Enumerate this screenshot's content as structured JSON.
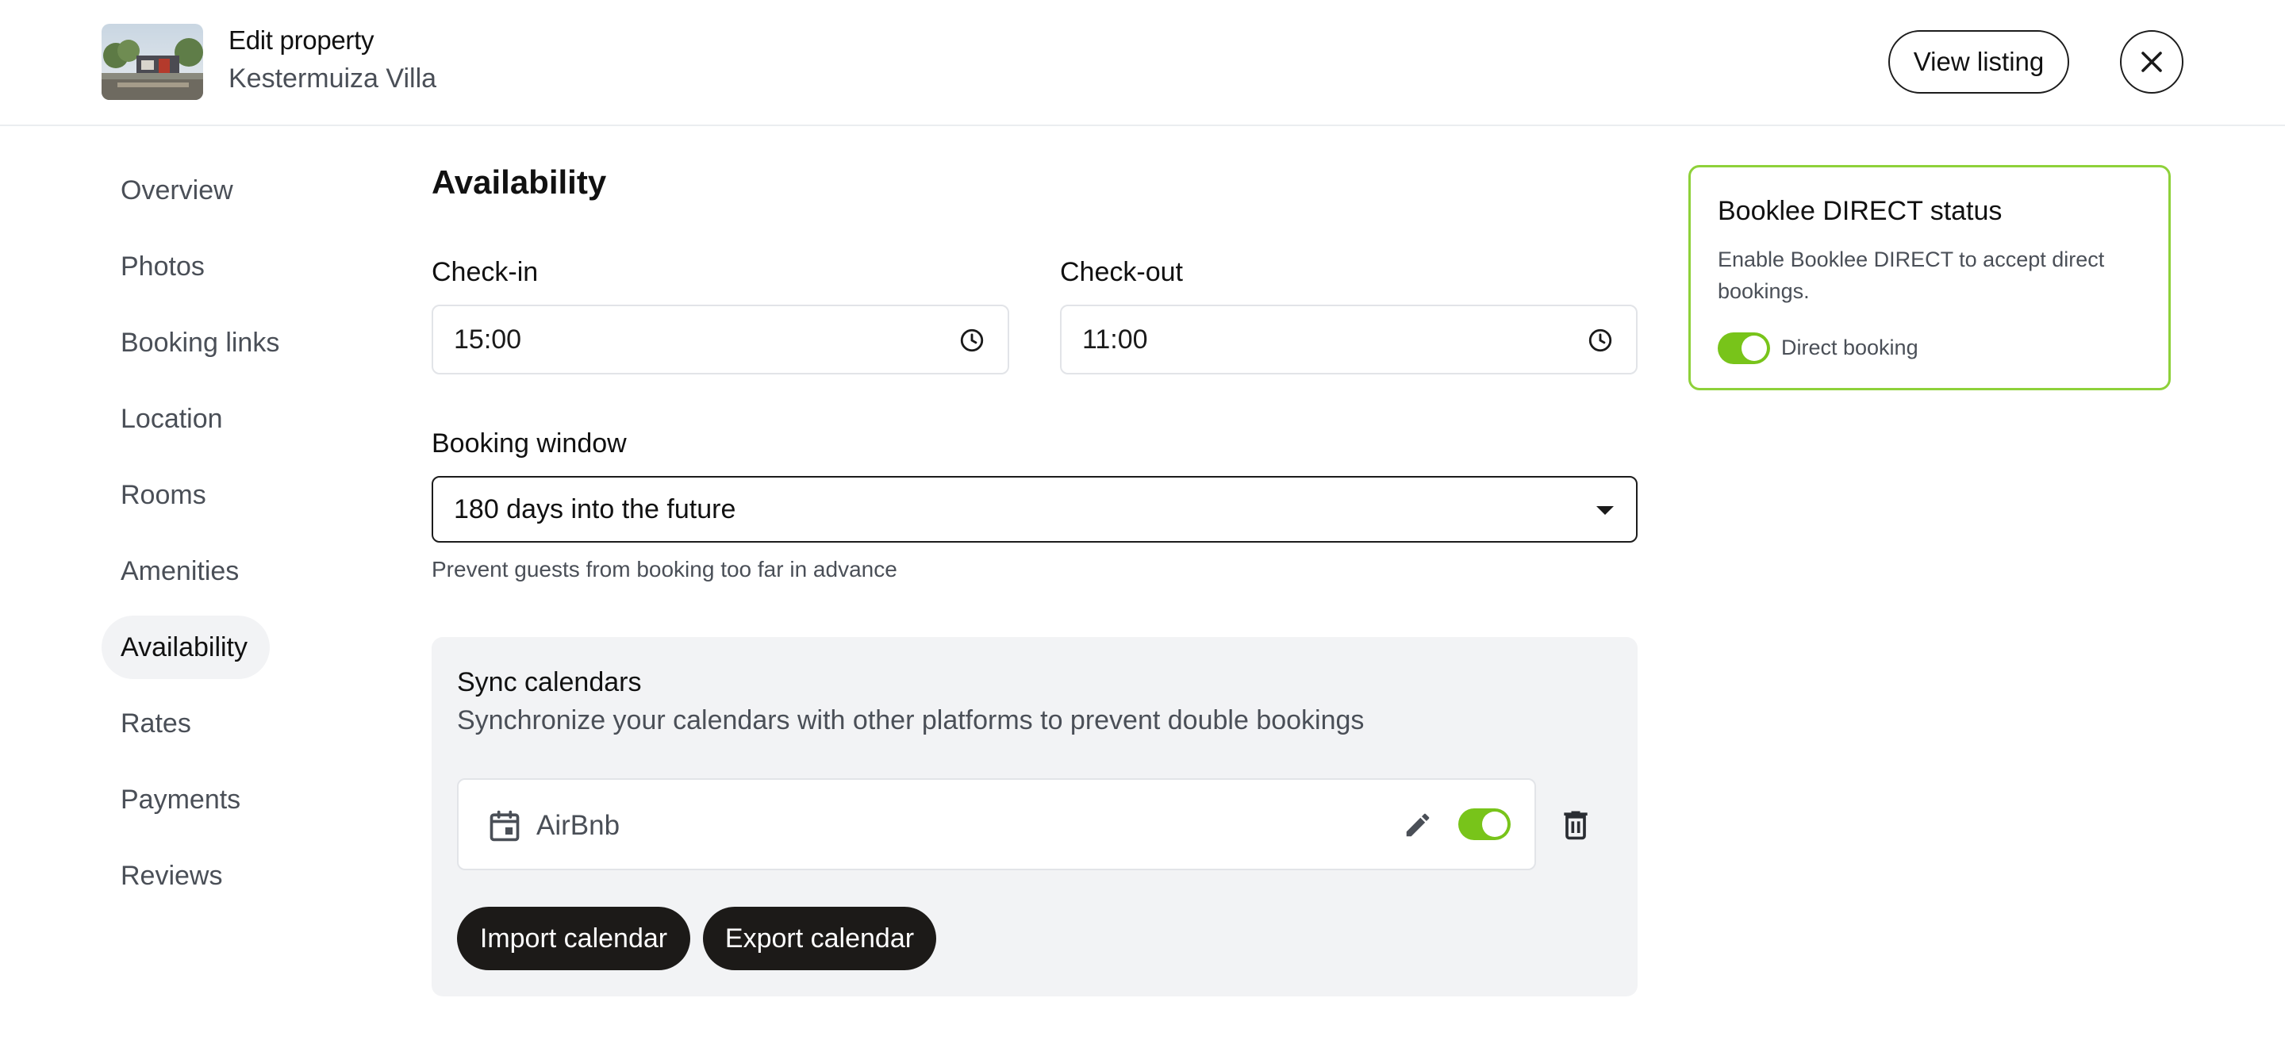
{
  "header": {
    "title": "Edit property",
    "property_name": "Kestermuiza Villa",
    "view_listing_label": "View listing"
  },
  "sidebar": {
    "items": [
      {
        "label": "Overview"
      },
      {
        "label": "Photos"
      },
      {
        "label": "Booking links"
      },
      {
        "label": "Location"
      },
      {
        "label": "Rooms"
      },
      {
        "label": "Amenities"
      },
      {
        "label": "Availability",
        "active": true
      },
      {
        "label": "Rates"
      },
      {
        "label": "Payments"
      },
      {
        "label": "Reviews"
      }
    ]
  },
  "main": {
    "title": "Availability",
    "checkin": {
      "label": "Check-in",
      "value": "15:00"
    },
    "checkout": {
      "label": "Check-out",
      "value": "11:00"
    },
    "booking_window": {
      "label": "Booking window",
      "value": "180 days into the future",
      "help": "Prevent guests from booking too far in advance"
    },
    "sync": {
      "title": "Sync calendars",
      "description": "Synchronize your calendars with other platforms to prevent double bookings",
      "calendars": [
        {
          "name": "AirBnb",
          "enabled": true
        }
      ],
      "import_label": "Import calendar",
      "export_label": "Export calendar"
    }
  },
  "status_card": {
    "title": "Booklee DIRECT status",
    "description": "Enable Booklee DIRECT to accept direct bookings.",
    "toggle_label": "Direct booking",
    "enabled": true
  },
  "colors": {
    "accent_green": "#78c41a",
    "card_border_green": "#8ed13a",
    "dark_button": "#1c1a18",
    "panel_bg": "#f2f3f5"
  }
}
